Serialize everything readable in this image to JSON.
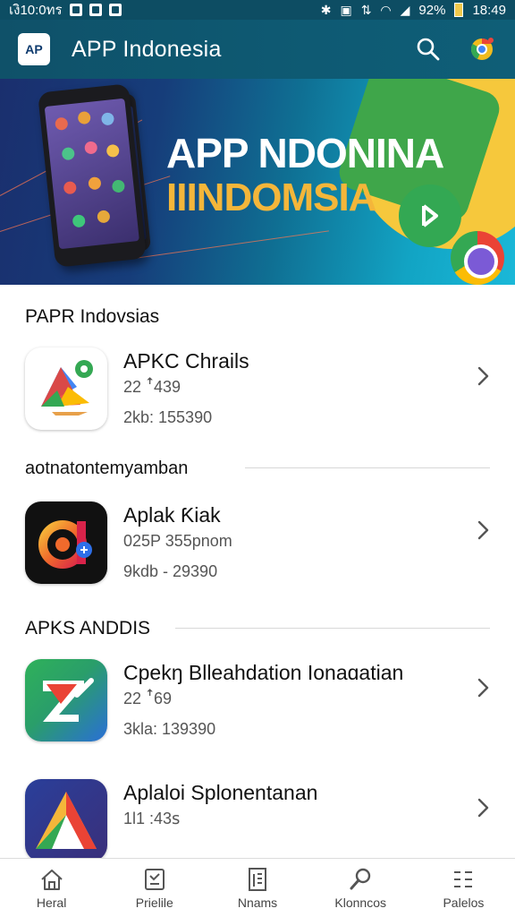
{
  "status_bar": {
    "left_text": "เงิ10:0ทร",
    "battery_percent": "92%",
    "time": "18:49"
  },
  "app_bar": {
    "logo_text": "AP",
    "title": "APP Indonesia",
    "actions": [
      "search-icon",
      "chrome-icon"
    ]
  },
  "banner": {
    "headline_1": "APP NDONINA",
    "headline_2": "IIINDOMSIA"
  },
  "sections": [
    {
      "header": "PAPR Indovsias",
      "items": [
        {
          "title": "APKC Chrails",
          "sub1": "22 ꜛ439",
          "sub2": "2kb: 155390",
          "icon": "google-maps-like-icon"
        }
      ]
    },
    {
      "header": "aotnatontemyamban",
      "items": [
        {
          "title": "Aplak Ƙiak",
          "sub1": "025P 355pnom",
          "sub2": "9kdb - 29390",
          "icon": "colorful-a-icon"
        }
      ]
    },
    {
      "header": "APKS ANDDIS",
      "items": [
        {
          "title": "Cpekŋ Blleahdation Ionaɑatian",
          "sub1": "22 ꜛ69",
          "sub2": "3kla: 139390",
          "icon": "green-arrow-icon"
        },
        {
          "title": "Aplaloi Splonentanan",
          "sub1": "1l1 :43ꜱ",
          "sub2": "",
          "icon": "triangle-logo-icon"
        }
      ]
    }
  ],
  "bottom_nav": [
    {
      "label": "Heral",
      "icon": "home-icon"
    },
    {
      "label": "Prielile",
      "icon": "profile-icon"
    },
    {
      "label": "Nnams",
      "icon": "document-icon"
    },
    {
      "label": "Klonncos",
      "icon": "search-icon"
    },
    {
      "label": "Palelos",
      "icon": "list-icon"
    }
  ],
  "colors": {
    "app_bar": "#0f5169",
    "banner_gold": "#f4b63a",
    "accent_green": "#34a853"
  }
}
